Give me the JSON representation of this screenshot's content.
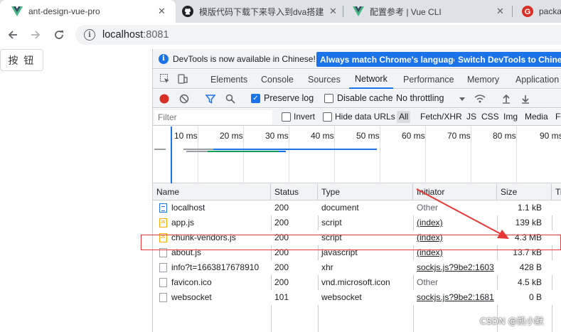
{
  "browser": {
    "tabs": [
      {
        "title": "ant-design-vue-pro",
        "icon": "vue-logo-icon",
        "active": true
      },
      {
        "title": "模版代码下载下来导入到dva搭建",
        "icon": "github-icon",
        "active": false
      },
      {
        "title": "配置参考 | Vue CLI",
        "icon": "vue-logo-icon",
        "active": false
      },
      {
        "title": "packa",
        "icon": "g-logo-icon",
        "active": false
      }
    ],
    "address": {
      "host": "localhost",
      "port": ":8081"
    }
  },
  "page": {
    "button_label": "按 钮"
  },
  "devtools": {
    "infobar": {
      "message": "DevTools is now available in Chinese!",
      "match_button": "Always match Chrome's language",
      "switch_button": "Switch DevTools to Chinese"
    },
    "panel_tabs": [
      "Elements",
      "Console",
      "Sources",
      "Network",
      "Performance",
      "Memory",
      "Application"
    ],
    "active_panel": "Network",
    "toolbar": {
      "preserve_log": "Preserve log",
      "disable_cache": "Disable cache",
      "throttling": "No throttling"
    },
    "filter": {
      "placeholder": "Filter",
      "invert": "Invert",
      "hide_data_urls": "Hide data URLs",
      "types": [
        "All",
        "Fetch/XHR",
        "JS",
        "CSS",
        "Img",
        "Media",
        "Fo"
      ]
    },
    "overview": {
      "ticks": [
        "10 ms",
        "20 ms",
        "30 ms",
        "40 ms",
        "50 ms",
        "60 ms",
        "70 ms",
        "80 ms",
        "90 ms"
      ]
    },
    "columns": [
      "Name",
      "Status",
      "Type",
      "Initiator",
      "Size",
      "Ti"
    ],
    "requests": [
      {
        "name": "localhost",
        "icon": "document-icon",
        "status": "200",
        "type": "document",
        "initiator": "Other",
        "initiator_link": false,
        "size": "1.1 kB"
      },
      {
        "name": "app.js",
        "icon": "script-icon",
        "status": "200",
        "type": "script",
        "initiator": "(index)",
        "initiator_link": true,
        "size": "139 kB"
      },
      {
        "name": "chunk-vendors.js",
        "icon": "script-icon",
        "status": "200",
        "type": "script",
        "initiator": "(index)",
        "initiator_link": true,
        "size": "4.3 MB"
      },
      {
        "name": "about.js",
        "icon": "file-icon",
        "status": "200",
        "type": "javascript",
        "initiator": "(index)",
        "initiator_link": true,
        "size": "13.7 kB"
      },
      {
        "name": "info?t=1663817678910",
        "icon": "file-icon",
        "status": "200",
        "type": "xhr",
        "initiator": "sockjs.js?9be2:1603",
        "initiator_link": true,
        "size": "428 B"
      },
      {
        "name": "favicon.ico",
        "icon": "file-icon",
        "status": "200",
        "type": "vnd.microsoft.icon",
        "initiator": "Other",
        "initiator_link": false,
        "size": "4.5 kB"
      },
      {
        "name": "websocket",
        "icon": "file-icon",
        "status": "101",
        "type": "websocket",
        "initiator": "sockjs.js?9be2:1681",
        "initiator_link": true,
        "size": "0 B"
      }
    ]
  },
  "watermark": "CSDN @凯小默",
  "colors": {
    "accent": "#1a73e8",
    "annotation_red": "#e53935",
    "record_red": "#d93025"
  }
}
